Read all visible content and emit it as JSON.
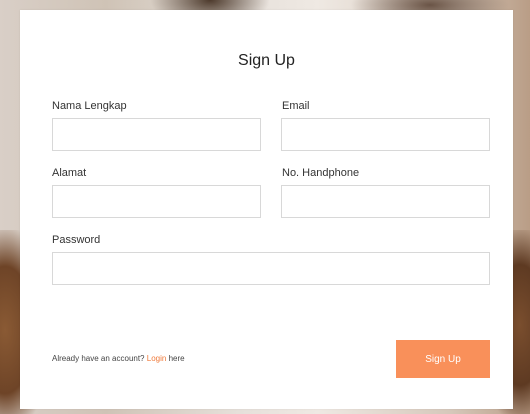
{
  "form": {
    "title": "Sign Up",
    "fields": {
      "full_name": {
        "label": "Nama Lengkap",
        "value": "",
        "placeholder": ""
      },
      "email": {
        "label": "Email",
        "value": "",
        "placeholder": ""
      },
      "address": {
        "label": "Alamat",
        "value": "",
        "placeholder": ""
      },
      "phone": {
        "label": "No. Handphone",
        "value": "",
        "placeholder": ""
      },
      "password": {
        "label": "Password",
        "value": "",
        "placeholder": ""
      }
    },
    "footer": {
      "prefix": "Already have an account?",
      "link": "Login",
      "suffix": "here"
    },
    "submit_label": "Sign Up"
  },
  "colors": {
    "accent": "#f9905a",
    "link": "#f07a3a",
    "card_bg": "#ffffff",
    "border": "#d8d8d8"
  }
}
